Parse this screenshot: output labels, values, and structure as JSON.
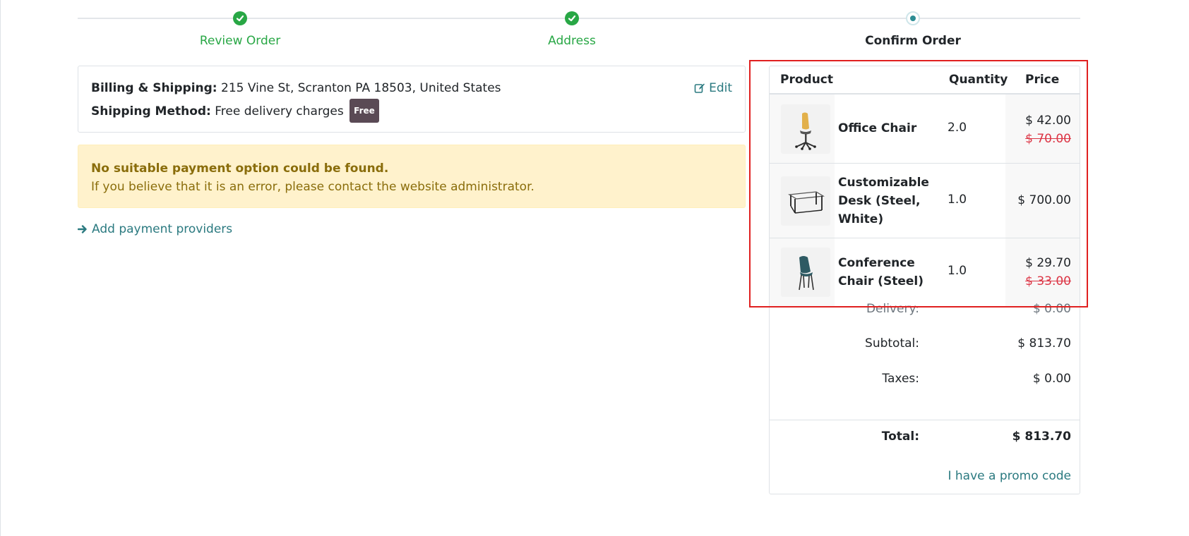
{
  "wizard": {
    "steps": [
      {
        "label": "Review Order",
        "state": "done"
      },
      {
        "label": "Address",
        "state": "done"
      },
      {
        "label": "Confirm Order",
        "state": "current"
      }
    ]
  },
  "address": {
    "billing_label": "Billing & Shipping:",
    "billing_value": "215 Vine St, Scranton PA 18503, United States",
    "method_label": "Shipping Method:",
    "method_value": "Free delivery charges",
    "method_badge": "Free",
    "edit_label": "Edit"
  },
  "warning": {
    "title": "No suitable payment option could be found.",
    "message": "If you believe that it is an error, please contact the website administrator."
  },
  "add_providers_label": "Add payment providers",
  "cart": {
    "headers": {
      "product": "Product",
      "quantity": "Quantity",
      "price": "Price"
    },
    "items": [
      {
        "name": "Office Chair",
        "quantity": "2.0",
        "price": "$ 42.00",
        "old_price": "$ 70.00",
        "image_icon": "office-chair-icon"
      },
      {
        "name": "Customizable Desk (Steel, White)",
        "quantity": "1.0",
        "price": "$ 700.00",
        "old_price": "",
        "image_icon": "desk-icon"
      },
      {
        "name": "Conference Chair (Steel)",
        "quantity": "1.0",
        "price": "$ 29.70",
        "old_price": "$ 33.00",
        "image_icon": "conference-chair-icon"
      }
    ],
    "delivery_label": "Delivery:",
    "delivery_value": "$ 0.00",
    "subtotal_label": "Subtotal:",
    "subtotal_value": "$ 813.70",
    "taxes_label": "Taxes:",
    "taxes_value": "$ 0.00",
    "total_label": "Total:",
    "total_value": "$ 813.70",
    "promo_label": "I have a promo code"
  },
  "colors": {
    "success": "#28a745",
    "link": "#2b7a80",
    "danger": "#dc3545",
    "warning_bg": "#fff2cc",
    "highlight": "#e02020"
  }
}
